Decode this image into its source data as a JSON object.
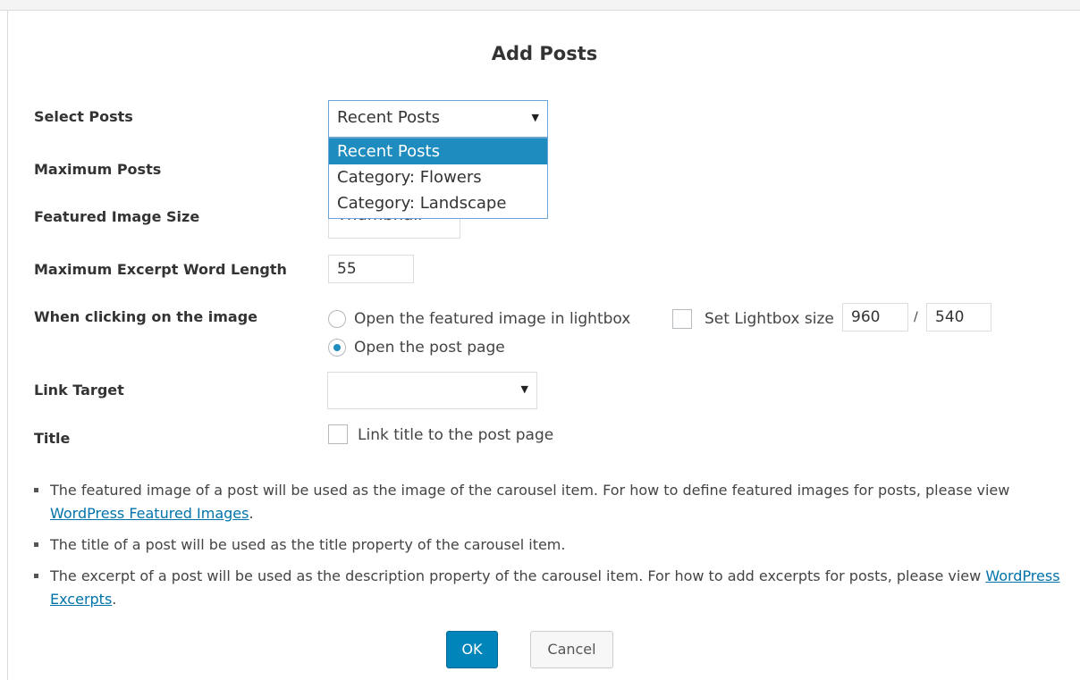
{
  "dialog": {
    "title": "Add Posts"
  },
  "fields": {
    "select_posts": {
      "label": "Select Posts",
      "value": "Recent Posts",
      "options": [
        "Recent Posts",
        "Category: Flowers",
        "Category: Landscape"
      ]
    },
    "maximum_posts": {
      "label": "Maximum Posts"
    },
    "featured_image_size": {
      "label": "Featured Image Size",
      "value": "Thumbnail"
    },
    "max_excerpt_length": {
      "label": "Maximum Excerpt Word Length",
      "value": "55"
    },
    "click_image": {
      "label": "When clicking on the image",
      "option_lightbox": "Open the featured image in lightbox",
      "option_post_page": "Open the post page",
      "selected": "option_post_page",
      "lightbox_size_label": "Set Lightbox size",
      "lightbox_width": "960",
      "lightbox_separator": "/",
      "lightbox_height": "540"
    },
    "link_target": {
      "label": "Link Target",
      "value": ""
    },
    "title": {
      "label": "Title",
      "link_title_label": "Link title to the post page"
    }
  },
  "notes": [
    {
      "text_before": "The featured image of a post will be used as the image of the carousel item. For how to define featured images for posts, please view ",
      "link": "WordPress Featured Images",
      "text_after": "."
    },
    {
      "text_before": "The title of a post will be used as the title property of the carousel item.",
      "link": "",
      "text_after": ""
    },
    {
      "text_before": "The excerpt of a post will be used as the description property of the carousel item. For how to add excerpts for posts, please view ",
      "link": "WordPress Excerpts",
      "text_after": "."
    }
  ],
  "buttons": {
    "ok": "OK",
    "cancel": "Cancel"
  },
  "icons": {
    "dropdown_arrow": "▼"
  },
  "colors": {
    "primary_button": "#0085ba",
    "link": "#0073aa",
    "selected_option": "#1e8cbe",
    "focus_border": "#6aa5d8"
  }
}
